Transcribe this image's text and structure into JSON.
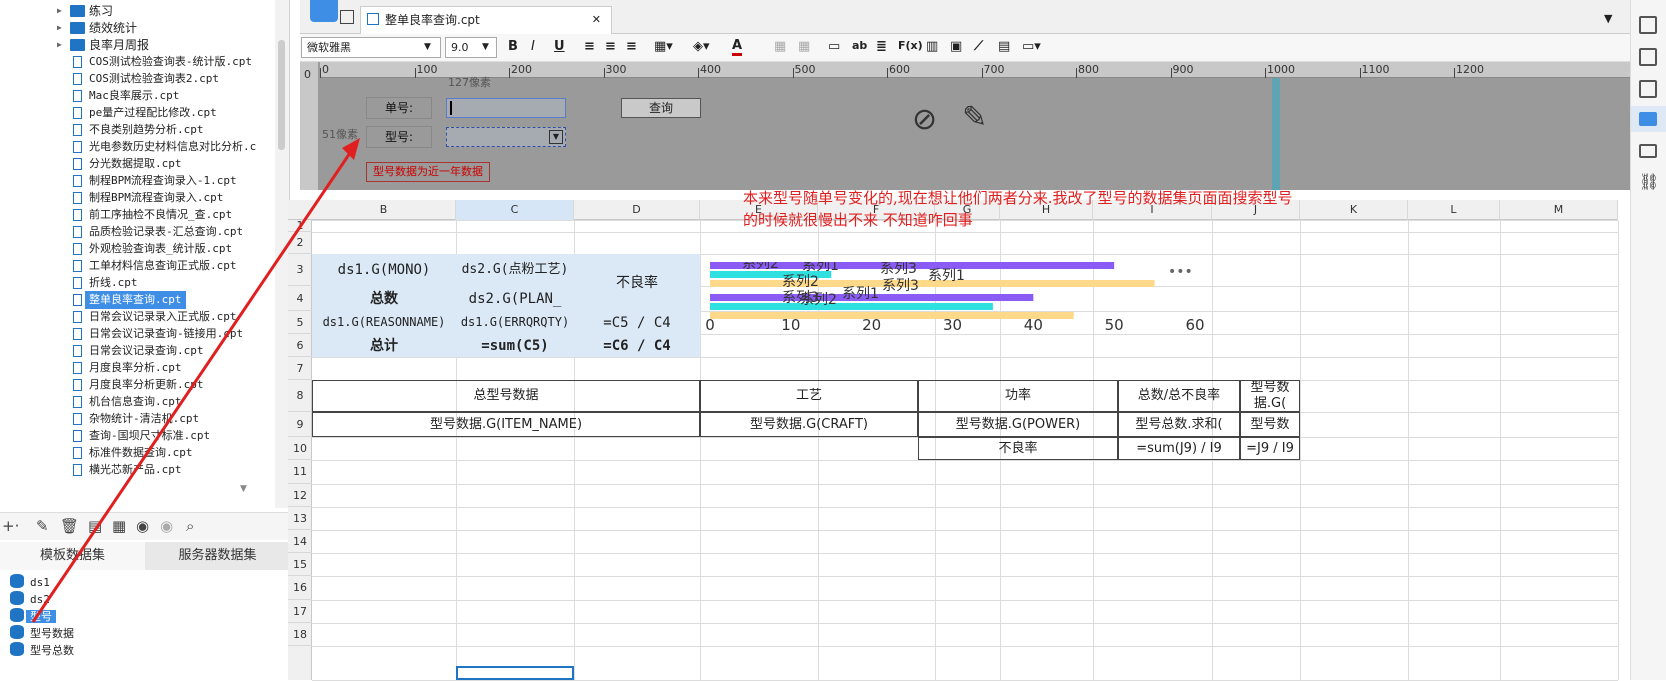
{
  "tree": {
    "folders": [
      "练习",
      "绩效统计",
      "良率月周报"
    ],
    "files": [
      "COS测试检验查询表-统计版.cpt",
      "COS测试检验查询表2.cpt",
      "Mac良率展示.cpt",
      "pe量产过程配比修改.cpt",
      "不良类别趋势分析.cpt",
      "光电参数历史材料信息对比分析.c",
      "分光数据提取.cpt",
      "制程BPM流程查询录入-1.cpt",
      "制程BPM流程查询录入.cpt",
      "前工序抽检不良情况_查.cpt",
      "品质检验记录表-汇总查询.cpt",
      "外观检验查询表_统计版.cpt",
      "工单材料信息查询正式版.cpt",
      "折线.cpt",
      "整单良率查询.cpt",
      "日常会议记录录入正式版.cpt",
      "日常会议记录查询-链接用.cpt",
      "日常会议记录查询.cpt",
      "月度良率分析.cpt",
      "月度良率分析更新.cpt",
      "机台信息查询.cpt",
      "杂物统计-清洁机.cpt",
      "查询-国坝尺寸标准.cpt",
      "标准件数据查询.cpt",
      "横光芯新产品.cpt"
    ]
  },
  "dataset_tabs": [
    "模板数据集",
    "服务器数据集"
  ],
  "datasets": [
    "ds1",
    "ds2",
    "型号",
    "型号数据",
    "型号总数"
  ],
  "editor_tab": {
    "title": "整单良率查询.cpt",
    "close": "✕"
  },
  "format": {
    "font": "微软雅黑",
    "size": "9.0"
  },
  "ruler": [
    "0",
    "100",
    "200",
    "300",
    "400",
    "500",
    "600",
    "700",
    "800",
    "900",
    "1000",
    "1100",
    "1200"
  ],
  "param": {
    "hint_top": "127像素",
    "hint_left": "51像素",
    "label1": "单号:",
    "label2": "型号:",
    "query_button": "查询",
    "red_label": "型号数据为近一年数据"
  },
  "annotation": "本来型号随单号变化的,现在想让他们两者分来.我改了型号的数据集页面面搜索型号的时候就很慢出不来 不知道咋回事",
  "columns": [
    "B",
    "C",
    "D",
    "E",
    "F",
    "G",
    "H",
    "I",
    "J",
    "K",
    "L",
    "M"
  ],
  "rows": [
    "1",
    "2",
    "3",
    "4",
    "5",
    "6",
    "7",
    "8",
    "9",
    "10",
    "11",
    "12",
    "13",
    "14",
    "15",
    "16",
    "17",
    "18"
  ],
  "cells": {
    "b3": "ds1.G(MONO)",
    "c3": "ds2.G(点粉工艺)",
    "d34": "不良率",
    "b4": "总数",
    "c4": "ds2.G(PLAN_",
    "b5": "ds1.G(REASONNAME)",
    "c5": "ds1.G(ERRQRQTY)",
    "d5": "=C5 / C4",
    "b6": "总计",
    "c6": "=sum(C5)",
    "d6": "=C6 / C4",
    "h8a": "总型号数据",
    "h8b": "工艺",
    "h8c": "功率",
    "h8d": "总数/总不良率",
    "h8e": "型号数据.G(",
    "r9a": "型号数据.G(ITEM_NAME)",
    "r9b": "型号数据.G(CRAFT)",
    "r9c": "型号数据.G(POWER)",
    "r9d": "型号总数.求和(",
    "r9e": "型号数",
    "r10c": "不良率",
    "r10d": "=sum(J9) / I9",
    "r10e": "=J9 / I9"
  },
  "chart_data": {
    "type": "bar",
    "orientation": "horizontal",
    "series": [
      {
        "name": "系列1",
        "color": "#8a5cf5",
        "values": [
          50,
          40
        ]
      },
      {
        "name": "系列2",
        "color": "#2fe0e0",
        "values": [
          15,
          35
        ]
      },
      {
        "name": "系列3",
        "color": "#ffd98a",
        "values": [
          55,
          45
        ]
      }
    ],
    "xticks": [
      "0",
      "10",
      "20",
      "30",
      "40",
      "50",
      "60"
    ],
    "xlim": [
      0,
      60
    ],
    "labels": [
      "系列2",
      "系列1",
      "系列3",
      "系列1",
      "系列2",
      "系列3",
      "系列3",
      "系列2",
      "系列1"
    ],
    "more": "•••"
  },
  "colors": {
    "accent": "#3e8ee6",
    "annotation": "#e02020"
  }
}
